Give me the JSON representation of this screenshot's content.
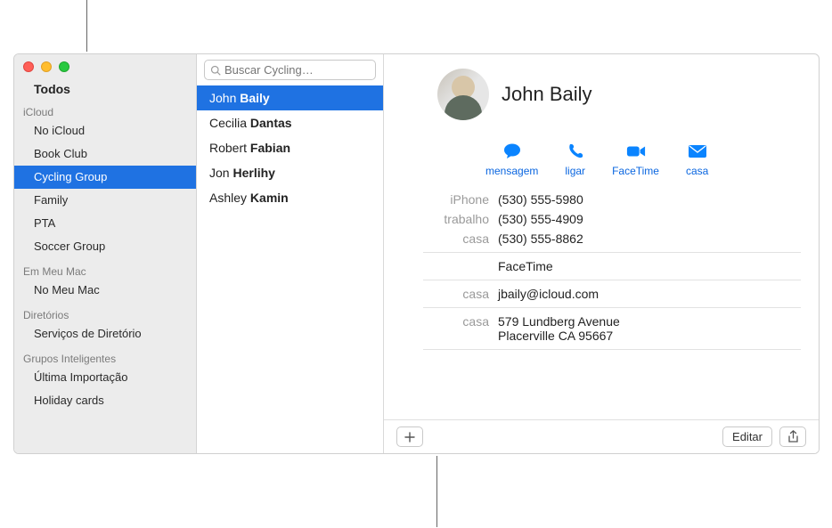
{
  "sidebar": {
    "all": "Todos",
    "sections": [
      {
        "header": "iCloud",
        "items": [
          {
            "label": "No iCloud",
            "selected": false
          },
          {
            "label": "Book Club",
            "selected": false
          },
          {
            "label": "Cycling Group",
            "selected": true
          },
          {
            "label": "Family",
            "selected": false
          },
          {
            "label": "PTA",
            "selected": false
          },
          {
            "label": "Soccer Group",
            "selected": false
          }
        ]
      },
      {
        "header": "Em Meu Mac",
        "items": [
          {
            "label": "No Meu Mac",
            "selected": false
          }
        ]
      },
      {
        "header": "Diretórios",
        "items": [
          {
            "label": "Serviços de Diretório",
            "selected": false
          }
        ]
      },
      {
        "header": "Grupos Inteligentes",
        "items": [
          {
            "label": "Última Importação",
            "selected": false
          },
          {
            "label": "Holiday cards",
            "selected": false
          }
        ]
      }
    ]
  },
  "search": {
    "placeholder": "Buscar Cycling…"
  },
  "contacts": [
    {
      "first": "John",
      "last": "Baily",
      "selected": true
    },
    {
      "first": "Cecilia",
      "last": "Dantas",
      "selected": false
    },
    {
      "first": "Robert",
      "last": "Fabian",
      "selected": false
    },
    {
      "first": "Jon",
      "last": "Herlihy",
      "selected": false
    },
    {
      "first": "Ashley",
      "last": "Kamin",
      "selected": false
    }
  ],
  "detail": {
    "name": "John Baily",
    "actions": {
      "message": "mensagem",
      "call": "ligar",
      "facetime": "FaceTime",
      "mail": "casa"
    },
    "phones": [
      {
        "label": "iPhone",
        "value": "(530) 555-5980"
      },
      {
        "label": "trabalho",
        "value": "(530) 555-4909"
      },
      {
        "label": "casa",
        "value": "(530) 555-8862"
      }
    ],
    "facetime_label": "FaceTime",
    "email": {
      "label": "casa",
      "value": "jbaily@icloud.com"
    },
    "address": {
      "label": "casa",
      "line1": "579 Lundberg Avenue",
      "line2": "Placerville CA 95667"
    },
    "edit_button": "Editar"
  },
  "icons": {
    "add": "plus-icon",
    "share": "share-icon"
  }
}
